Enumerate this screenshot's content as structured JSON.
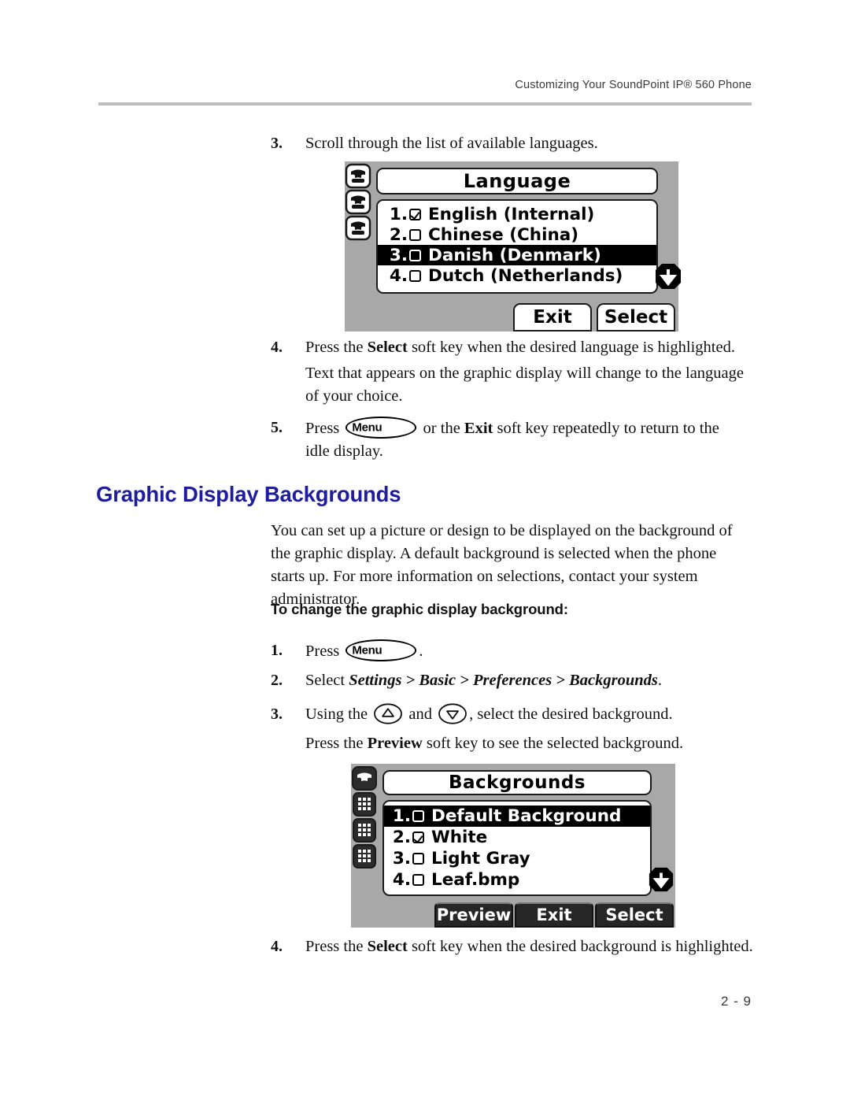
{
  "header": {
    "running_head": "Customizing Your SoundPoint IP® 560 Phone"
  },
  "footer": {
    "page_number": "2 - 9"
  },
  "colors": {
    "heading_blue": "#1d1d9e",
    "rule_gray": "#bdbdbd",
    "phone_body_gray": "#a8a8a8",
    "lcd_background": "#ffffff",
    "lcd_highlight": "#000000"
  },
  "steps_language": {
    "step3": {
      "number": "3.",
      "text": "Scroll through the list of available languages."
    },
    "step4": {
      "number": "4.",
      "text_before": "Press the ",
      "bold": "Select",
      "text_after": " soft key when the desired language is highlighted.",
      "continuation": "Text that appears on the graphic display will change to the language of your choice."
    },
    "step5": {
      "number": "5.",
      "text_before": "Press ",
      "key_label": "Menu",
      "text_middle": " or the ",
      "bold": "Exit",
      "text_after": " soft key repeatedly to return to the idle display."
    }
  },
  "language_screen": {
    "title": "Language",
    "items": [
      {
        "index": "1.",
        "label": "English (Internal)",
        "checked": true,
        "highlighted": false
      },
      {
        "index": "2.",
        "label": "Chinese (China)",
        "checked": false,
        "highlighted": false
      },
      {
        "index": "3.",
        "label": "Danish (Denmark)",
        "checked": false,
        "highlighted": true
      },
      {
        "index": "4.",
        "label": "Dutch (Netherlands)",
        "checked": false,
        "highlighted": false
      }
    ],
    "scroll_indicator": "scroll-down-arrow",
    "softkeys": [
      "Exit",
      "Select"
    ],
    "line_keys": [
      "line-key-icon",
      "line-key-icon",
      "line-key-icon"
    ]
  },
  "section": {
    "heading": "Graphic Display Backgrounds",
    "paragraph": "You can set up a picture or design to be displayed on the background of the graphic display. A default background is selected when the phone starts up. For more information on selections, contact your system administrator.",
    "sub_heading": "To change the graphic display background:"
  },
  "steps_background": {
    "step1": {
      "number": "1.",
      "text_before": "Press ",
      "key_label": "Menu",
      "text_after": "."
    },
    "step2": {
      "number": "2.",
      "text_before": "Select ",
      "path": "Settings > Basic > Preferences > Backgrounds",
      "text_after": "."
    },
    "step3": {
      "number": "3.",
      "text_before": "Using the ",
      "text_middle": " and ",
      "text_after": ", select the desired background.",
      "continuation_before": "Press the ",
      "continuation_bold": "Preview",
      "continuation_after": " soft key to see the selected background."
    },
    "step4": {
      "number": "4.",
      "text_before": "Press the ",
      "bold": "Select",
      "text_after": " soft key when the desired background is highlighted."
    }
  },
  "backgrounds_screen": {
    "title": "Backgrounds",
    "items": [
      {
        "index": "1.",
        "label": "Default Background",
        "checked": false,
        "highlighted": true
      },
      {
        "index": "2.",
        "label": "White",
        "checked": true,
        "highlighted": false
      },
      {
        "index": "3.",
        "label": "Light Gray",
        "checked": false,
        "highlighted": false
      },
      {
        "index": "4.",
        "label": "Leaf.bmp",
        "checked": false,
        "highlighted": false
      }
    ],
    "scroll_indicator": "scroll-down-arrow",
    "softkeys": [
      "Preview",
      "Exit",
      "Select"
    ],
    "line_keys": [
      "line-key-icon",
      "keypad-icon",
      "keypad-icon",
      "keypad-icon"
    ]
  }
}
